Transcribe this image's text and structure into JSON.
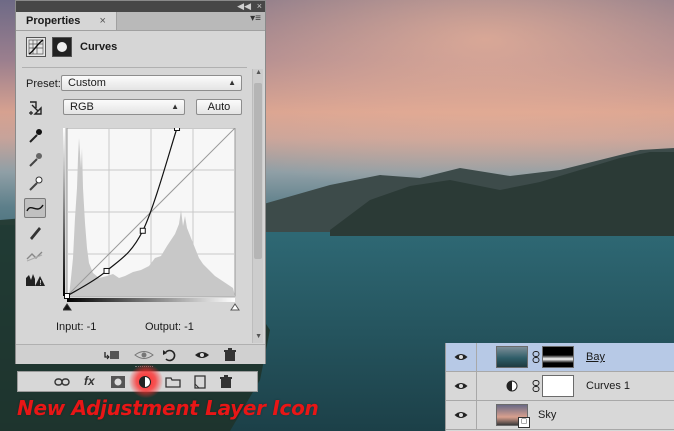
{
  "panel": {
    "title": "Properties",
    "close_glyph": "×",
    "header_title": "Curves",
    "preset_label": "Preset:",
    "preset_value": "Custom",
    "channel_value": "RGB",
    "auto_label": "Auto",
    "input_label": "Input:",
    "input_value": "-1",
    "output_label": "Output:",
    "output_value": "-1",
    "tools": [
      "on-image-adjust-icon",
      "eyedropper-black-icon",
      "eyedropper-gray-icon",
      "eyedropper-white-icon",
      "curve-points-icon",
      "pencil-icon",
      "smooth-icon",
      "clipping-warning-icon"
    ],
    "bottom_icons": [
      "clip-to-layer-icon",
      "view-previous-icon",
      "reset-icon",
      "visibility-icon",
      "trash-icon"
    ]
  },
  "curve": {
    "points": [
      [
        0,
        0
      ],
      [
        60,
        38
      ],
      [
        115,
        99
      ],
      [
        167,
        255
      ]
    ]
  },
  "layers_footer": {
    "icons": [
      "link-icon",
      "fx-icon",
      "mask-icon",
      "adjustment-layer-icon",
      "folder-icon",
      "new-layer-icon",
      "trash-icon"
    ],
    "fx_label": "fx"
  },
  "caption": "New Adjustment Layer Icon",
  "layers": [
    {
      "name": "Bay",
      "selected": true
    },
    {
      "name": "Curves 1",
      "selected": false
    },
    {
      "name": "Sky",
      "selected": false
    }
  ],
  "colors": {
    "caption": "#e81616",
    "selected_row": "#b7c9e6",
    "glow": "#ff2a2a"
  }
}
